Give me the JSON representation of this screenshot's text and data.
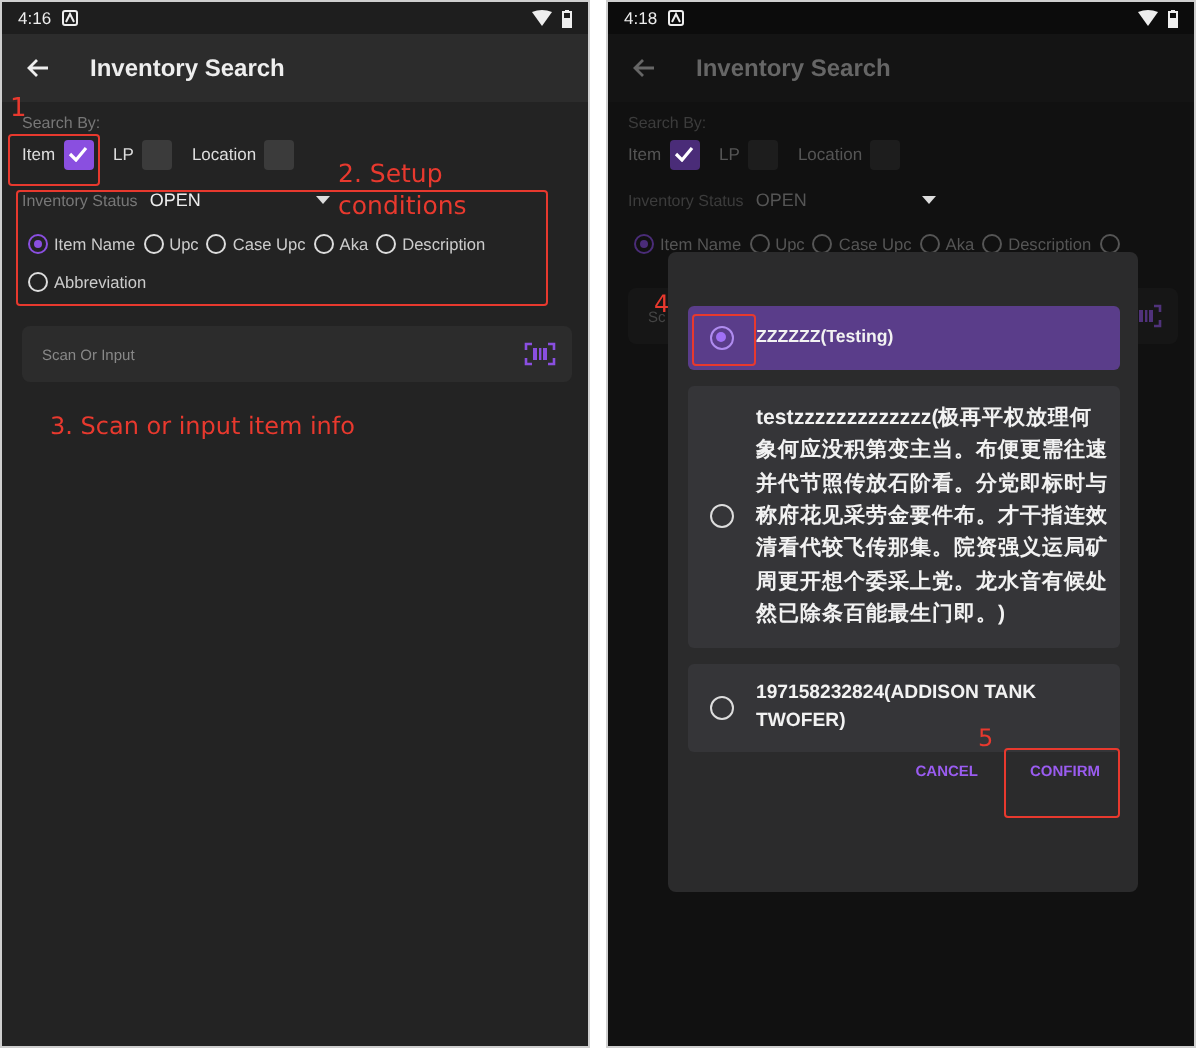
{
  "screens": [
    {
      "status_bar": {
        "time": "4:16"
      },
      "title": "Inventory Search",
      "dimmed": false,
      "search_by_label": "Search By:",
      "checkboxes": [
        {
          "label": "Item",
          "checked": true
        },
        {
          "label": "LP",
          "checked": false
        },
        {
          "label": "Location",
          "checked": false
        }
      ],
      "status_field": {
        "label": "Inventory Status",
        "value": "OPEN"
      },
      "search_types": [
        {
          "label": "Item Name",
          "selected": true
        },
        {
          "label": "Upc",
          "selected": false
        },
        {
          "label": "Case Upc",
          "selected": false
        },
        {
          "label": "Aka",
          "selected": false
        },
        {
          "label": "Description",
          "selected": false
        },
        {
          "label": "Abbreviation",
          "selected": false
        }
      ],
      "scan_field": {
        "placeholder": "Scan Or Input"
      },
      "annotations": [
        {
          "text": "1"
        },
        {
          "text": "2. Setup conditions"
        },
        {
          "text": "3. Scan or input item info"
        }
      ]
    },
    {
      "status_bar": {
        "time": "4:18"
      },
      "title": "Inventory Search",
      "dimmed": true,
      "search_by_label": "Search By:",
      "checkboxes": [
        {
          "label": "Item",
          "checked": true
        },
        {
          "label": "LP",
          "checked": false
        },
        {
          "label": "Location",
          "checked": false
        }
      ],
      "status_field": {
        "label": "Inventory Status",
        "value": "OPEN"
      },
      "search_types": [
        {
          "label": "Item Name",
          "selected": true
        },
        {
          "label": "Upc",
          "selected": false
        },
        {
          "label": "Case Upc",
          "selected": false
        },
        {
          "label": "Aka",
          "selected": false
        },
        {
          "label": "Description",
          "selected": false
        },
        {
          "selected": false
        }
      ],
      "scan_field": {
        "placeholder": "Sc"
      },
      "dialog": {
        "options": [
          {
            "label": "ZZZZZZ(Testing)",
            "selected": true
          },
          {
            "label": "testzzzzzzzzzzzzz(极再平权放理何象何应没积第变主当。布便更需往速并代节照传放石阶看。分党即标时与称府花见采劳金要件布。才干指连效清看代较飞传那集。院资强义运局矿周更开想个委采上党。龙水音有候处然已除条百能最生门即。)",
            "selected": false
          },
          {
            "label": "197158232824(ADDISON TANK TWOFER)",
            "selected": false
          }
        ],
        "buttons": [
          "CANCEL",
          "CONFIRM"
        ]
      },
      "annotations": [
        {
          "text": "4"
        },
        {
          "text": "5"
        }
      ]
    }
  ]
}
